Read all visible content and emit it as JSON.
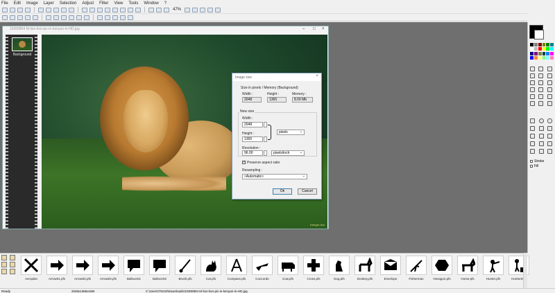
{
  "menu": [
    "File",
    "Edit",
    "Image",
    "Layer",
    "Selection",
    "Adjust",
    "Filter",
    "View",
    "Tools",
    "Window",
    "?"
  ],
  "toolbar": {
    "zoom": "47%"
  },
  "image_window": {
    "title": "10300804 M-lion-lion-pic-in-kenyan-in-HD.jpg",
    "layer_name": "Background",
    "watermark": "Kenyan lion"
  },
  "dialog": {
    "title": "Image size",
    "size_header": "Size in pixels / Memory (Background)",
    "width_label": "Width :",
    "height_label": "Height :",
    "memory_label": "Memory :",
    "width_value": "2048",
    "height_value": "1365",
    "memory_value": "8.00 Mb",
    "new_size_label": "New size",
    "new_width_label": "Width :",
    "new_width_value": "2048",
    "new_height_label": "Height :",
    "new_height_value": "1365",
    "unit": "pixels",
    "resolution_label": "Resolution :",
    "resolution_value": "96.00",
    "resolution_unit": "pixels/inch",
    "preserve_label": "Preserve aspect ratio",
    "resampling_label": "Resampling :",
    "resampling_value": "<Automatic>",
    "ok_label": "Ok",
    "cancel_label": "Cancel"
  },
  "right_panel": {
    "stroke_label": "Stroke",
    "fill_label": "Fill"
  },
  "palette_colors": [
    "#000000",
    "#808080",
    "#800000",
    "#808000",
    "#008000",
    "#008080",
    "#ffffff",
    "#c0c0c0",
    "#ff0000",
    "#ffff00",
    "#00ff00",
    "#00ffff",
    "#000080",
    "#800080",
    "#808040",
    "#004040",
    "#0080ff",
    "#ff00ff",
    "#0000ff",
    "#ff8040",
    "#ffff80",
    "#80ff80",
    "#80ffff",
    "#ff80c0"
  ],
  "shapes": [
    {
      "name": "Aeroplan",
      "icon": "aeroplane-icon"
    },
    {
      "name": "Arrow01.pfs",
      "icon": "arrow-icon"
    },
    {
      "name": "Arrow02.pfs",
      "icon": "arrow-icon"
    },
    {
      "name": "Arrow03.pfs",
      "icon": "arrow-icon"
    },
    {
      "name": "Balloon01",
      "icon": "balloon-icon"
    },
    {
      "name": "Balloon02",
      "icon": "balloon-icon"
    },
    {
      "name": "Brush.pfs",
      "icon": "brush-icon"
    },
    {
      "name": "Cat.pfs",
      "icon": "cat-icon"
    },
    {
      "name": "Compass.pfs",
      "icon": "compass-icon"
    },
    {
      "name": "Concorde",
      "icon": "concorde-icon"
    },
    {
      "name": "Cow.pfs",
      "icon": "cow-icon"
    },
    {
      "name": "Cross.pfs",
      "icon": "cross-icon"
    },
    {
      "name": "Dog.pfs",
      "icon": "dog-icon"
    },
    {
      "name": "Donkey.pfs",
      "icon": "donkey-icon"
    },
    {
      "name": "Envelope",
      "icon": "envelope-icon"
    },
    {
      "name": "Fisherman",
      "icon": "fisherman-icon"
    },
    {
      "name": "Hexagon.pfs",
      "icon": "hexagon-icon"
    },
    {
      "name": "Horse.pfs",
      "icon": "horse-icon"
    },
    {
      "name": "Hunter.pfs",
      "icon": "hunter-icon"
    },
    {
      "name": "HunterDog",
      "icon": "hunterdog-icon"
    }
  ],
  "status": {
    "ready": "Ready",
    "dimensions": "2048x1365x16M",
    "path": "C:\\Users\\79134\\Downloads\\10300804 M-lion-lion-pic-in-kenyan-in-HD.jpg"
  }
}
